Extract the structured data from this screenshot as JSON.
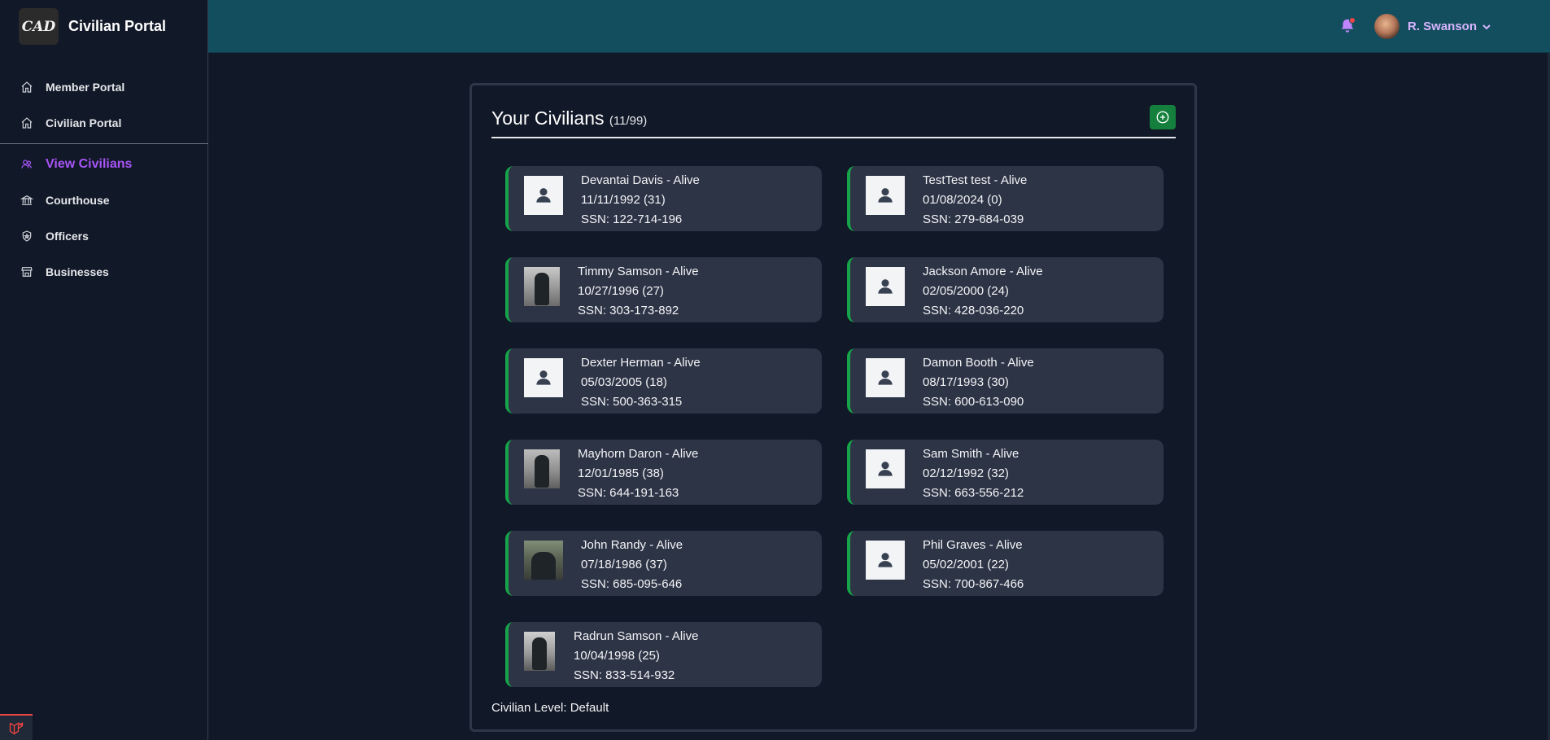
{
  "app": {
    "logo_text": "CAD",
    "title": "Civilian Portal"
  },
  "sidebar": {
    "items": [
      {
        "label": "Member Portal",
        "icon": "home-icon"
      },
      {
        "label": "Civilian Portal",
        "icon": "home-icon"
      },
      {
        "label": "View Civilians",
        "icon": "users-icon",
        "active": true
      },
      {
        "label": "Courthouse",
        "icon": "building-icon"
      },
      {
        "label": "Officers",
        "icon": "shield-icon"
      },
      {
        "label": "Businesses",
        "icon": "store-icon"
      }
    ]
  },
  "header": {
    "username": "R. Swanson",
    "notification_icon": "bell-icon"
  },
  "panel": {
    "title": "Your Civilians",
    "count": "(11/99)",
    "footer": "Civilian Level: Default"
  },
  "civilians": [
    {
      "name": "Devantai Davis - Alive",
      "dob": "11/11/1992 (31)",
      "ssn": "SSN: 122-714-196"
    },
    {
      "name": "TestTest test - Alive",
      "dob": "01/08/2024 (0)",
      "ssn": "SSN: 279-684-039"
    },
    {
      "name": "Timmy Samson - Alive",
      "dob": "10/27/1996 (27)",
      "ssn": "SSN: 303-173-892"
    },
    {
      "name": "Jackson Amore - Alive",
      "dob": "02/05/2000 (24)",
      "ssn": "SSN: 428-036-220"
    },
    {
      "name": "Dexter Herman - Alive",
      "dob": "05/03/2005 (18)",
      "ssn": "SSN: 500-363-315"
    },
    {
      "name": "Damon Booth - Alive",
      "dob": "08/17/1993 (30)",
      "ssn": "SSN: 600-613-090"
    },
    {
      "name": "Mayhorn Daron - Alive",
      "dob": "12/01/1985 (38)",
      "ssn": "SSN: 644-191-163"
    },
    {
      "name": "Sam Smith - Alive",
      "dob": "02/12/1992 (32)",
      "ssn": "SSN: 663-556-212"
    },
    {
      "name": "John Randy - Alive",
      "dob": "07/18/1986 (37)",
      "ssn": "SSN: 685-095-646"
    },
    {
      "name": "Phil Graves - Alive",
      "dob": "05/02/2001 (22)",
      "ssn": "SSN: 700-867-466"
    },
    {
      "name": "Radrun Samson - Alive",
      "dob": "10/04/1998 (25)",
      "ssn": "SSN: 833-514-932"
    }
  ],
  "colors": {
    "accent": "#a855f7",
    "topbar": "#134e5e",
    "status_alive": "#16a34a"
  }
}
